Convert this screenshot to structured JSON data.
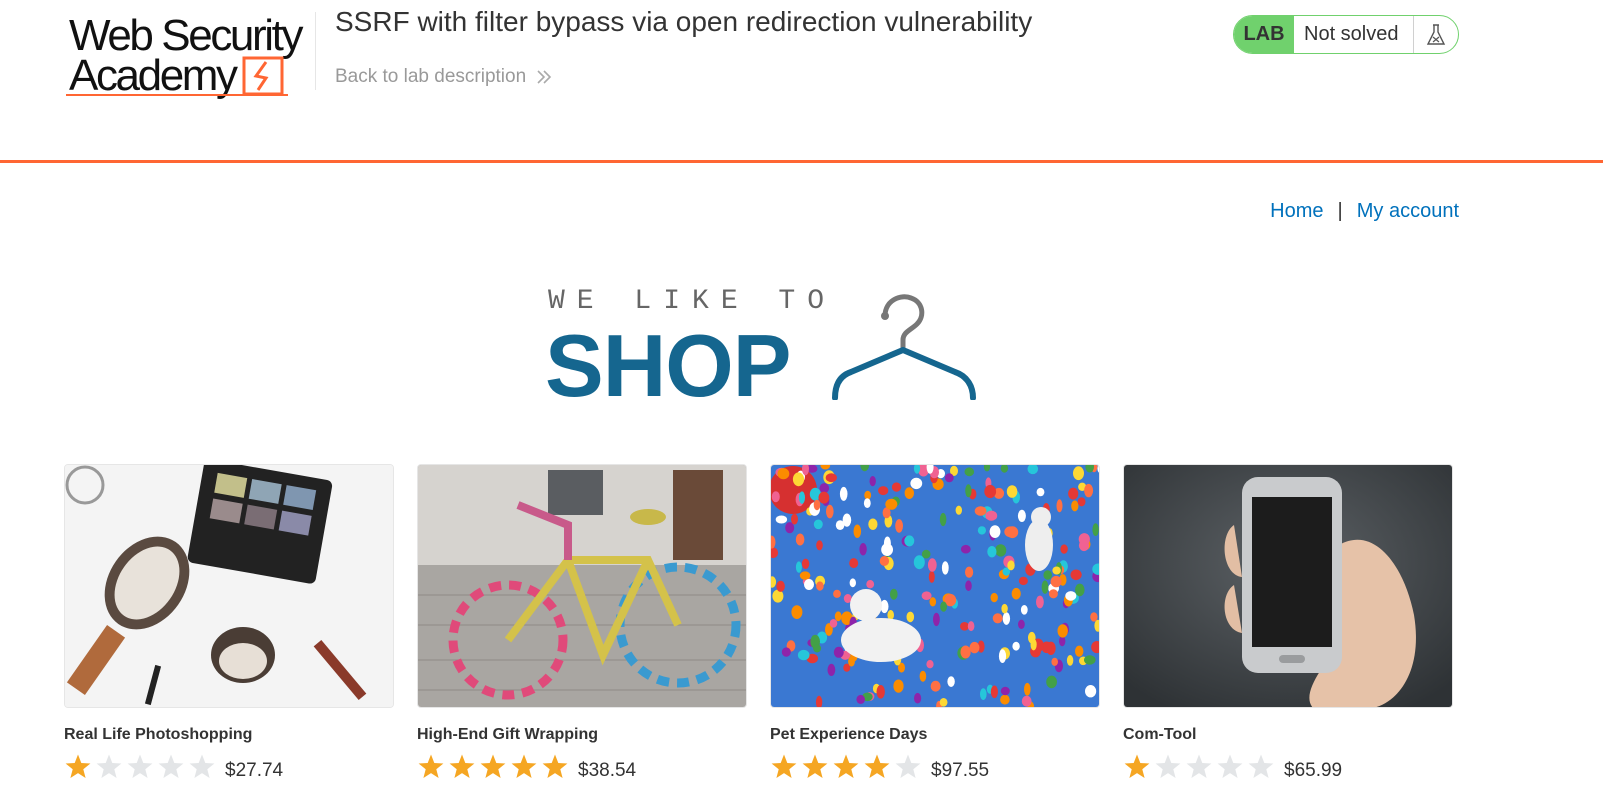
{
  "header": {
    "logo_line1": "Web Security",
    "logo_line2": "Academy",
    "lab_title": "SSRF with filter bypass via open redirection vulnerability",
    "back_link": "Back to lab description",
    "status_badge": "LAB",
    "status_text": "Not solved",
    "status_icon": "flask-icon",
    "accent_color": "#ff6633",
    "status_color": "#70d16d"
  },
  "nav": {
    "home": "Home",
    "separator": "|",
    "my_account": "My account",
    "link_color": "#0071bc"
  },
  "banner": {
    "tagline": "WE LIKE TO",
    "headline": "SHOP",
    "icon": "hanger-icon",
    "headline_color": "#15668f"
  },
  "products": [
    {
      "name": "Real Life Photoshopping",
      "rating": 1,
      "price": "$27.74",
      "image": "makeup-brushes-image"
    },
    {
      "name": "High-End Gift Wrapping",
      "rating": 5,
      "price": "$38.54",
      "image": "knitted-bicycle-image"
    },
    {
      "name": "Pet Experience Days",
      "rating": 4,
      "price": "$97.55",
      "image": "dogs-balloons-image"
    },
    {
      "name": "Com-Tool",
      "rating": 1,
      "price": "$65.99",
      "image": "smartphone-hand-image"
    }
  ]
}
